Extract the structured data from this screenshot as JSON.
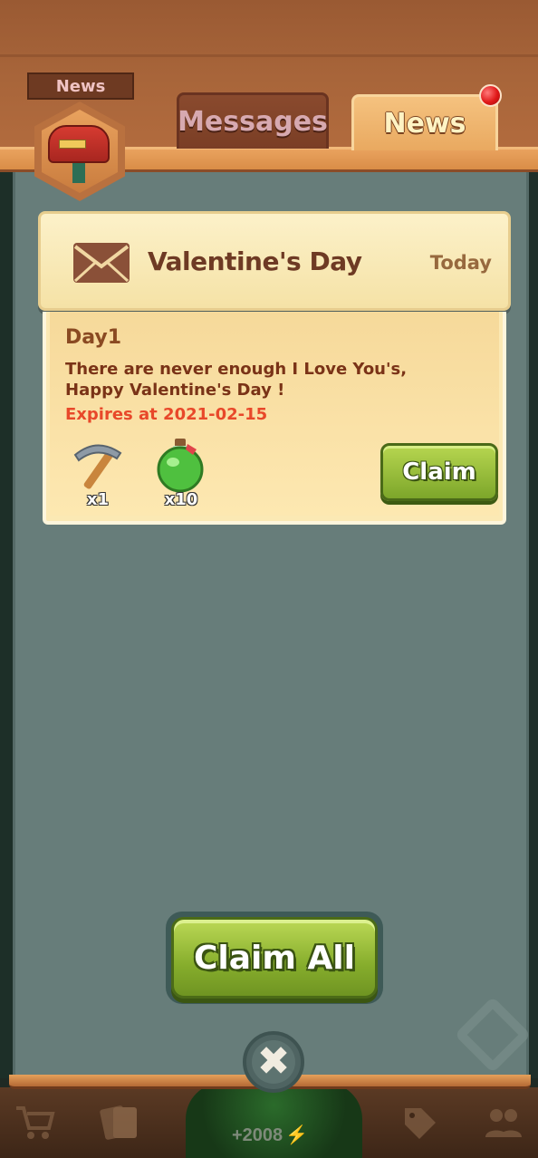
{
  "badge": {
    "label": "News",
    "icon": "mailbox-icon"
  },
  "tabs": [
    {
      "label": "Messages",
      "active": false
    },
    {
      "label": "News",
      "active": true,
      "has_notification": true
    }
  ],
  "news_item": {
    "icon": "envelope-icon",
    "title": "Valentine's Day",
    "date": "Today",
    "day_label": "Day1",
    "message": "There are never enough I Love You's, Happy Valentine's Day !",
    "expires": "Expires at 2021-02-15",
    "rewards": [
      {
        "icon": "pickaxe-icon",
        "count": "x1"
      },
      {
        "icon": "potion-icon",
        "count": "x10"
      }
    ],
    "claim_label": "Claim"
  },
  "claim_all_label": "Claim All",
  "close_icon": "close-icon",
  "bottom_bar": {
    "energy_text": "+2008",
    "icons": [
      "cart-icon",
      "cards-icon",
      "tag-icon",
      "friends-icon"
    ]
  },
  "colors": {
    "panel": "#677d7a",
    "wood": "#a8653a",
    "accent_green": "#86ad2c",
    "expires_red": "#e8482a"
  }
}
